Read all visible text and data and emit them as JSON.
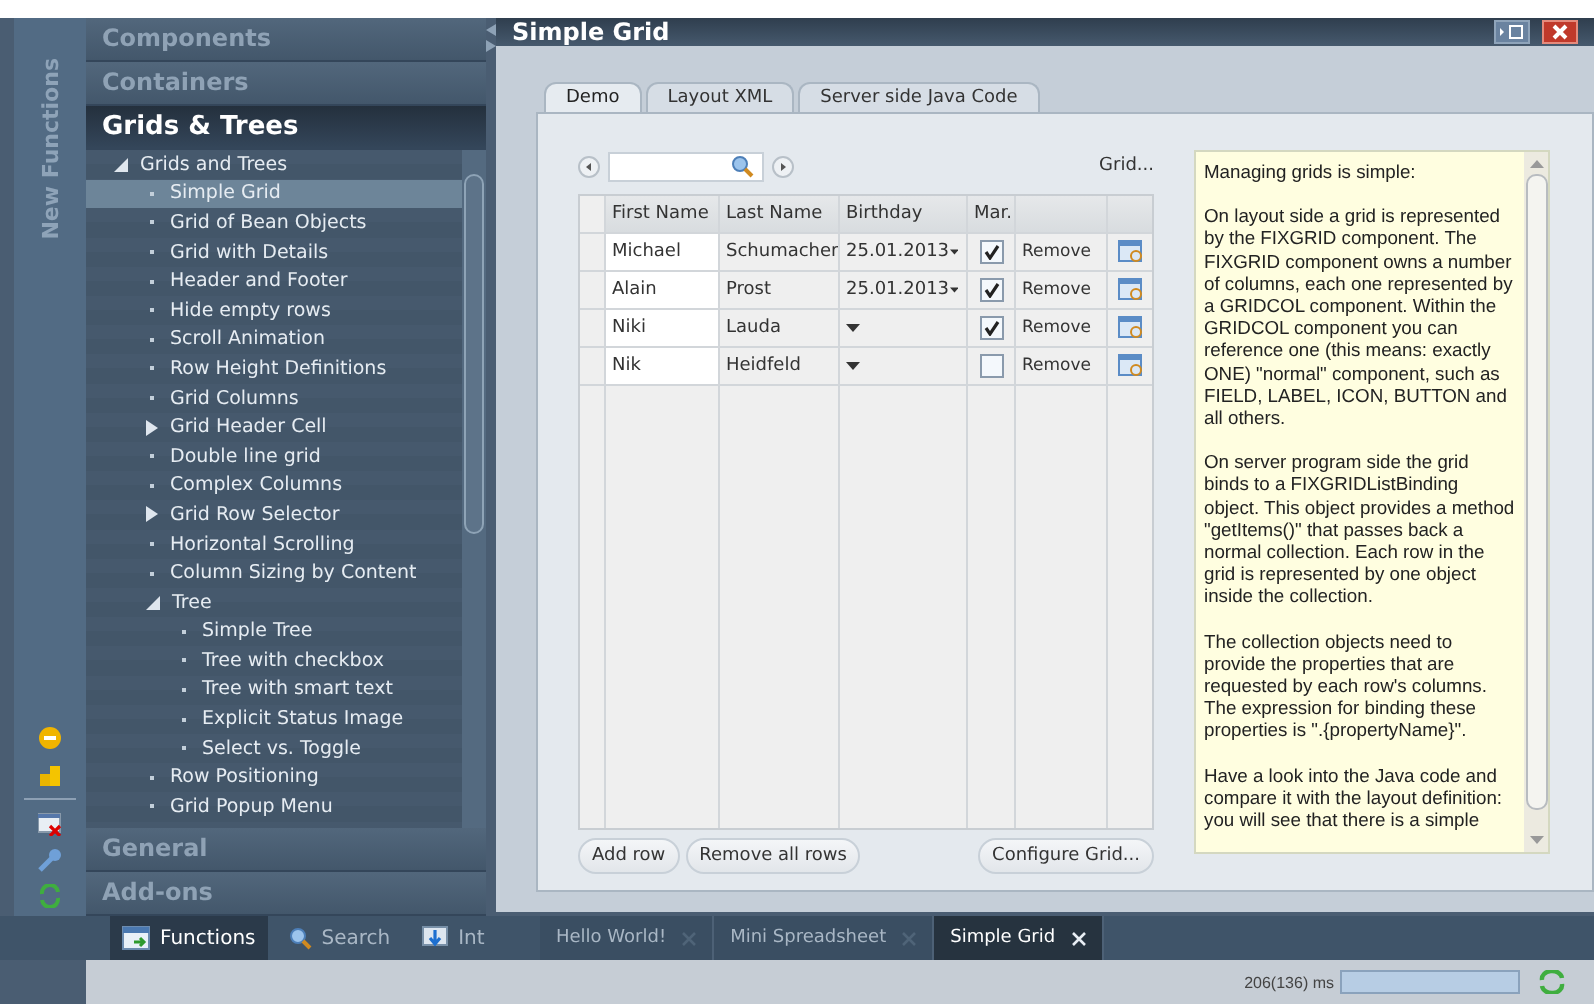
{
  "side_strip": {
    "label": "New Functions"
  },
  "nav": {
    "sections_top": [
      {
        "label": "Components",
        "selected": false
      },
      {
        "label": "Containers",
        "selected": false
      },
      {
        "label": "Grids & Trees",
        "selected": true
      }
    ],
    "tree": [
      {
        "kind": "folder",
        "label": "Grids and Trees",
        "expanded": true,
        "selected": false,
        "children": [
          {
            "kind": "leaf",
            "label": "Simple Grid",
            "selected": true
          },
          {
            "kind": "leaf",
            "label": "Grid of Bean Objects",
            "selected": false
          },
          {
            "kind": "leaf",
            "label": "Grid with Details",
            "selected": false
          },
          {
            "kind": "leaf",
            "label": "Header and Footer",
            "selected": false
          },
          {
            "kind": "leaf",
            "label": "Hide empty rows",
            "selected": false
          },
          {
            "kind": "leaf",
            "label": "Scroll Animation",
            "selected": false
          },
          {
            "kind": "leaf",
            "label": "Row Height Definitions",
            "selected": false
          },
          {
            "kind": "leaf",
            "label": "Grid Columns",
            "selected": false
          },
          {
            "kind": "folder",
            "label": "Grid Header Cell",
            "expanded": false,
            "selected": false
          },
          {
            "kind": "leaf",
            "label": "Double line grid",
            "selected": false
          },
          {
            "kind": "leaf",
            "label": "Complex Columns",
            "selected": false
          },
          {
            "kind": "folder",
            "label": "Grid Row Selector",
            "expanded": false,
            "selected": false
          },
          {
            "kind": "leaf",
            "label": "Horizontal Scrolling",
            "selected": false
          },
          {
            "kind": "leaf",
            "label": "Column Sizing by Content",
            "selected": false
          },
          {
            "kind": "folder",
            "label": "Tree",
            "expanded": true,
            "selected": false,
            "children": [
              {
                "kind": "leaf",
                "label": "Simple Tree",
                "selected": false
              },
              {
                "kind": "leaf",
                "label": "Tree with checkbox",
                "selected": false
              },
              {
                "kind": "leaf",
                "label": "Tree with smart text",
                "selected": false
              },
              {
                "kind": "leaf",
                "label": "Explicit Status Image",
                "selected": false
              },
              {
                "kind": "leaf",
                "label": "Select vs. Toggle",
                "selected": false
              }
            ]
          },
          {
            "kind": "leaf",
            "label": "Row Positioning",
            "selected": false
          },
          {
            "kind": "leaf",
            "label": "Grid Popup Menu",
            "selected": false
          }
        ]
      }
    ],
    "sections_bottom": [
      {
        "label": "General",
        "selected": false
      },
      {
        "label": "Add-ons",
        "selected": false
      }
    ]
  },
  "nav_tabs": [
    {
      "label": "Functions",
      "selected": true
    },
    {
      "label": "Search",
      "selected": false
    },
    {
      "label": "Int",
      "selected": false
    }
  ],
  "window": {
    "title": "Simple Grid"
  },
  "tabs": [
    {
      "label": "Demo",
      "selected": true
    },
    {
      "label": "Layout XML",
      "selected": false
    },
    {
      "label": "Server side Java Code",
      "selected": false
    }
  ],
  "grid": {
    "menu_label": "Grid...",
    "columns": [
      "First Name",
      "Last Name",
      "Birthday",
      "Mar."
    ],
    "rows": [
      {
        "first": "Michael",
        "last": "Schumacher",
        "birthday": "25.01.2013",
        "married": true,
        "action": "Remove"
      },
      {
        "first": "Alain",
        "last": "Prost",
        "birthday": "25.01.2013",
        "married": true,
        "action": "Remove"
      },
      {
        "first": "Niki",
        "last": "Lauda",
        "married": true,
        "action": "Remove"
      },
      {
        "first": "Nik",
        "last": "Heidfeld",
        "married": false,
        "action": "Remove"
      }
    ]
  },
  "grid_buttons": [
    "Add row",
    "Remove all rows"
  ],
  "configure_button": "Configure Grid...",
  "info": {
    "paragraphs": [
      "Managing grids is simple:",
      "On layout side a grid is represented by the FIXGRID component. The FIXGRID component owns a number of columns, each one represented by a GRIDCOL component. Within the GRIDCOL component you can reference one (this means: exactly ONE) \"normal\" component, such as FIELD, LABEL, ICON, BUTTON and all others.",
      "On server program side the grid binds to a FIXGRIDListBinding object. This object provides a method \"getItems()\" that passes back a normal collection. Each row in the grid is represented by one object inside the collection.",
      "The collection objects need to provide the properties that are requested by each row's columns. The expression for binding these properties is \".{propertyName}\".",
      "Have a look into the Java code and compare it with the layout definition: you will see that there is a simple"
    ]
  },
  "doc_tabs": [
    {
      "label": "Hello World!",
      "selected": false
    },
    {
      "label": "Mini Spreadsheet",
      "selected": false
    },
    {
      "label": "Simple Grid",
      "selected": true
    }
  ],
  "status": {
    "timing": "206(136) ms"
  }
}
